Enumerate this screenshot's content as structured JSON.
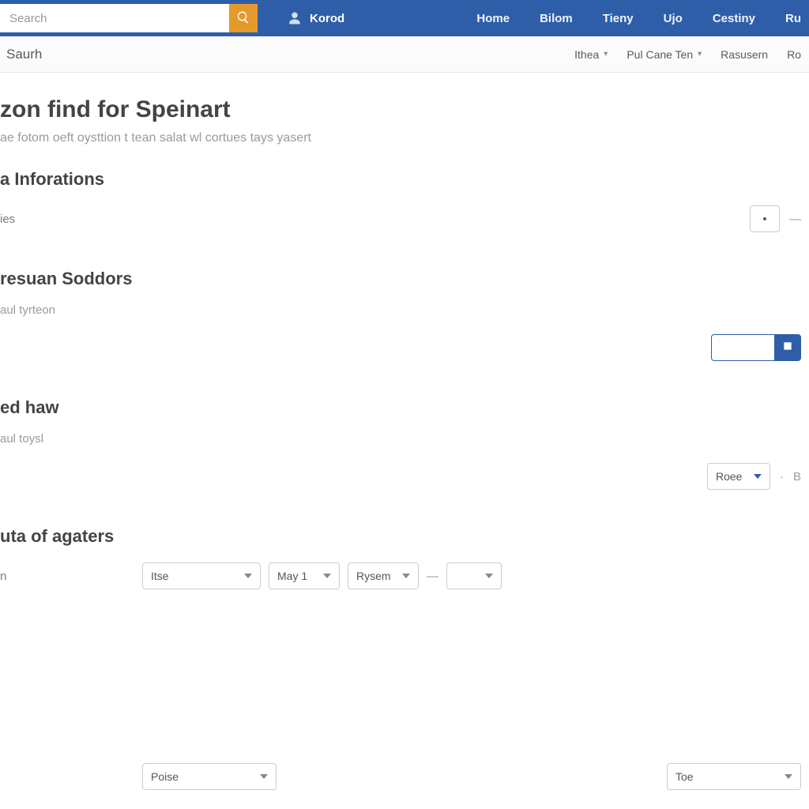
{
  "topbar": {
    "search_placeholder": "Search",
    "user_label": "Korod",
    "nav": [
      "Home",
      "Bilom",
      "Tieny",
      "Ujo",
      "Cestiny",
      "Ru"
    ]
  },
  "subbar": {
    "left_label": "Saurh",
    "links": [
      {
        "label": "Ithea",
        "caret": true
      },
      {
        "label": "Pul Cane Ten",
        "caret": true
      },
      {
        "label": "Rasusern",
        "caret": false
      },
      {
        "label": "Ro",
        "caret": false
      }
    ]
  },
  "page": {
    "title": "zon find for Speinart",
    "subtitle": "ae fotom oeft oysttion t tean salat wl cortues tays yasert"
  },
  "sections": [
    {
      "title": "a Inforations",
      "rows": [
        {
          "label": "ies",
          "right_stepper": "•",
          "right_sep": "—"
        }
      ]
    },
    {
      "title": "resuan Soddors",
      "hint": "aul tyrteon",
      "rows": [
        {
          "label": "",
          "input_group_value": ""
        }
      ]
    },
    {
      "title": "ed haw",
      "hint": "aul toysl",
      "rows": [
        {
          "label": "",
          "right_select": "Roee",
          "right_sep1": "·",
          "right_sep2": "B"
        }
      ]
    },
    {
      "title": "uta of agaters",
      "rows": [
        {
          "label": "n",
          "selects": [
            "Itse",
            "May 1",
            "Rysem"
          ],
          "sep": "—",
          "trailing_select": ""
        }
      ]
    }
  ],
  "footer": {
    "left_select": "Poise",
    "right_select": "Toe"
  }
}
